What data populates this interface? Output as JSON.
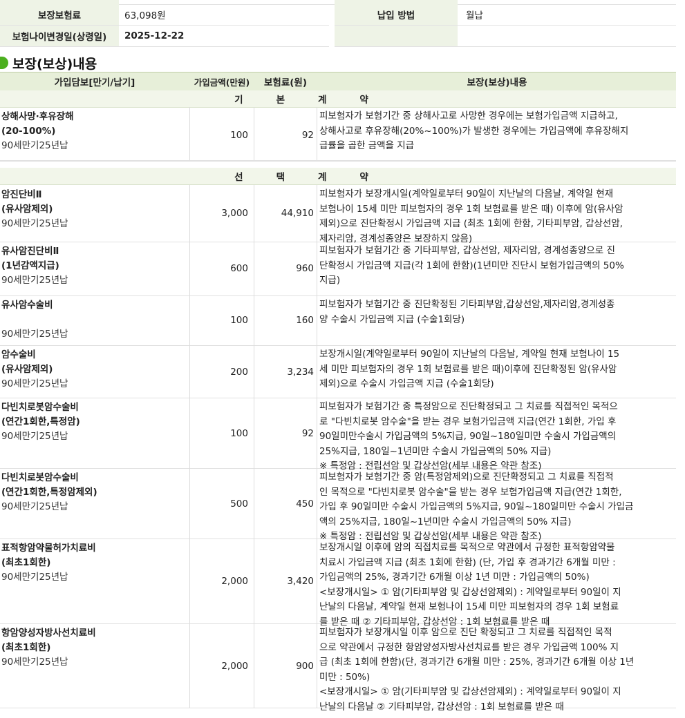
{
  "summary": {
    "left": [
      {
        "label": "보장보험료",
        "value": "63,098원"
      },
      {
        "label": "보험나이변경일(상령일)",
        "value": "2025-12-22"
      }
    ],
    "right": [
      {
        "label": "납입 방법",
        "value": "월납"
      }
    ]
  },
  "section": {
    "title": "보장(보상)내용"
  },
  "table": {
    "headers": {
      "coverage": "가입담보[만기/납기]",
      "amount": "가입금액(만원)",
      "premium": "보험료(원)",
      "details": "보장(보상)내용"
    },
    "groups": [
      {
        "label": "기본계약",
        "rows": [
          {
            "title": "상해사망·후유장해",
            "subtitle": "(20-100%)",
            "period": "90세만기25년납",
            "amount": "100",
            "premium": "92",
            "desc": [
              "피보험자가 보험기간 중 상해사고로 사망한 경우에는 보험가입금액 지급하고,",
              "상해사고로 후유장해(20%~100%)가 발생한 경우에는 가입금액에 후유장해지",
              "급률을 곱한 금액을 지급"
            ]
          }
        ]
      },
      {
        "label": "선택계약",
        "rows": [
          {
            "title": "암진단비Ⅱ",
            "subtitle": "(유사암제외)",
            "period": "90세만기25년납",
            "amount": "3,000",
            "premium": "44,910",
            "desc": [
              "피보험자가 보장개시일(계약일로부터 90일이 지난날의 다음날, 계약일 현재",
              "보험나이 15세 미만 피보험자의 경우 1회 보험료를 받은 때) 이후에 암(유사암",
              "제외)으로 진단확정시 가입금액 지급 (최초 1회에 한함, 기타피부암, 갑상선암,",
              "제자리암, 경계성종양은 보장하지 않음)"
            ]
          },
          {
            "title": "유사암진단비Ⅱ",
            "subtitle": "(1년감액지급)",
            "period": "90세만기25년납",
            "amount": "600",
            "premium": "960",
            "desc": [
              "피보험자가 보험기간 중 기타피부암, 갑상선암, 제자리암, 경계성종양으로 진",
              "단확정시 가입금액 지급(각 1회에 한함)(1년미만 진단시 보험가입금액의 50%",
              "지급)"
            ]
          },
          {
            "title": "유사암수술비",
            "subtitle": "",
            "period": "90세만기25년납",
            "amount": "100",
            "premium": "160",
            "desc": [
              "피보험자가 보험기간 중 진단확정된 기타피부암,갑상선암,제자리암,경계성종",
              "양 수술시 가입금액 지급 (수술1회당)"
            ]
          },
          {
            "title": "암수술비",
            "subtitle": "(유사암제외)",
            "period": "90세만기25년납",
            "amount": "200",
            "premium": "3,234",
            "desc": [
              "보장개시일(계약일로부터 90일이 지난날의 다음날, 계약일 현재 보험나이 15",
              "세 미만 피보험자의 경우 1회 보험료를 받은 때)이후에 진단확정된 암(유사암",
              "제외)으로 수술시 가입금액 지급 (수술1회당)"
            ]
          },
          {
            "title": "다빈치로봇암수술비",
            "subtitle": "(연간1회한,특정암)",
            "period": "90세만기25년납",
            "amount": "100",
            "premium": "92",
            "desc": [
              "피보험자가 보험기간 중 특정암으로 진단확정되고 그 치료를 직접적인 목적으",
              "로 \"다빈치로봇 암수술\"을 받는 경우 보험가입금액 지급(연간 1회한, 가입 후",
              "90일미만수술시 가입금액의 5%지급, 90일~180일미만 수술시 가입금액의",
              "25%지급, 180일~1년미만 수술시 가입금액의 50% 지급)",
              "※ 특정암 : 전립선암 및 갑상선암(세부 내용은 약관 참조)"
            ]
          },
          {
            "title": "다빈치로봇암수술비",
            "subtitle": "(연간1회한,특정암제외)",
            "period": "90세만기25년납",
            "amount": "500",
            "premium": "450",
            "desc": [
              "피보험자가 보험기간 중 암(특정암제외)으로 진단확정되고 그 치료를 직접적",
              "인 목적으로 \"다빈치로봇 암수술\"을 받는 경우 보험가입금액 지급(연간 1회한,",
              "가입 후 90일미만 수술시 가입금액의 5%지급, 90일~180일미만 수술시 가입금",
              "액의 25%지급, 180일~1년미만 수술시 가입금액의 50% 지급)",
              "※ 특정암 : 전립선암 및 갑상선암(세부 내용은 약관 참조)"
            ]
          },
          {
            "title": "표적항암약물허가치료비",
            "subtitle": "(최초1회한)",
            "period": "90세만기25년납",
            "amount": "2,000",
            "premium": "3,420",
            "desc": [
              "보장개시일 이후에 암의 직접치료를 목적으로 약관에서 규정한 표적항암약물",
              "치료시 가입금액 지급 (최초 1회에 한함) (단, 가입 후 경과기간 6개월 미만 :",
              "가입금액의 25%, 경과기간 6개월 이상 1년 미만 : 가입금액의 50%)",
              "<보장개시일> ① 암(기타피부암 및 갑상선암제외) : 계약일로부터 90일이 지",
              "난날의 다음날, 계약일 현재 보험나이 15세 미만 피보험자의 경우 1회 보험료",
              "를 받은 때 ② 기타피부암, 갑상선암 : 1회 보험료를 받은 때"
            ]
          },
          {
            "title": "항암양성자방사선치료비",
            "subtitle": "(최초1회한)",
            "period": "90세만기25년납",
            "amount": "2,000",
            "premium": "900",
            "desc": [
              "피보험자가 보장개시일 이후 암으로 진단 확정되고 그 치료를 직접적인 목적",
              "으로 약관에서 규정한 항암양성자방사선치료를 받은 경우 가입금액 100% 지",
              "급 (최초 1회에 한함)(단, 경과기간 6개월 미만 : 25%, 경과기간 6개월 이상 1년",
              "미만 : 50%)",
              "<보장개시일> ① 암(기타피부암 및 갑상선암제외) : 계약일로부터 90일이 지",
              "난날의 다음날 ② 기타피부암, 갑상선암 : 1회 보험료를 받은 때"
            ]
          }
        ]
      }
    ]
  }
}
